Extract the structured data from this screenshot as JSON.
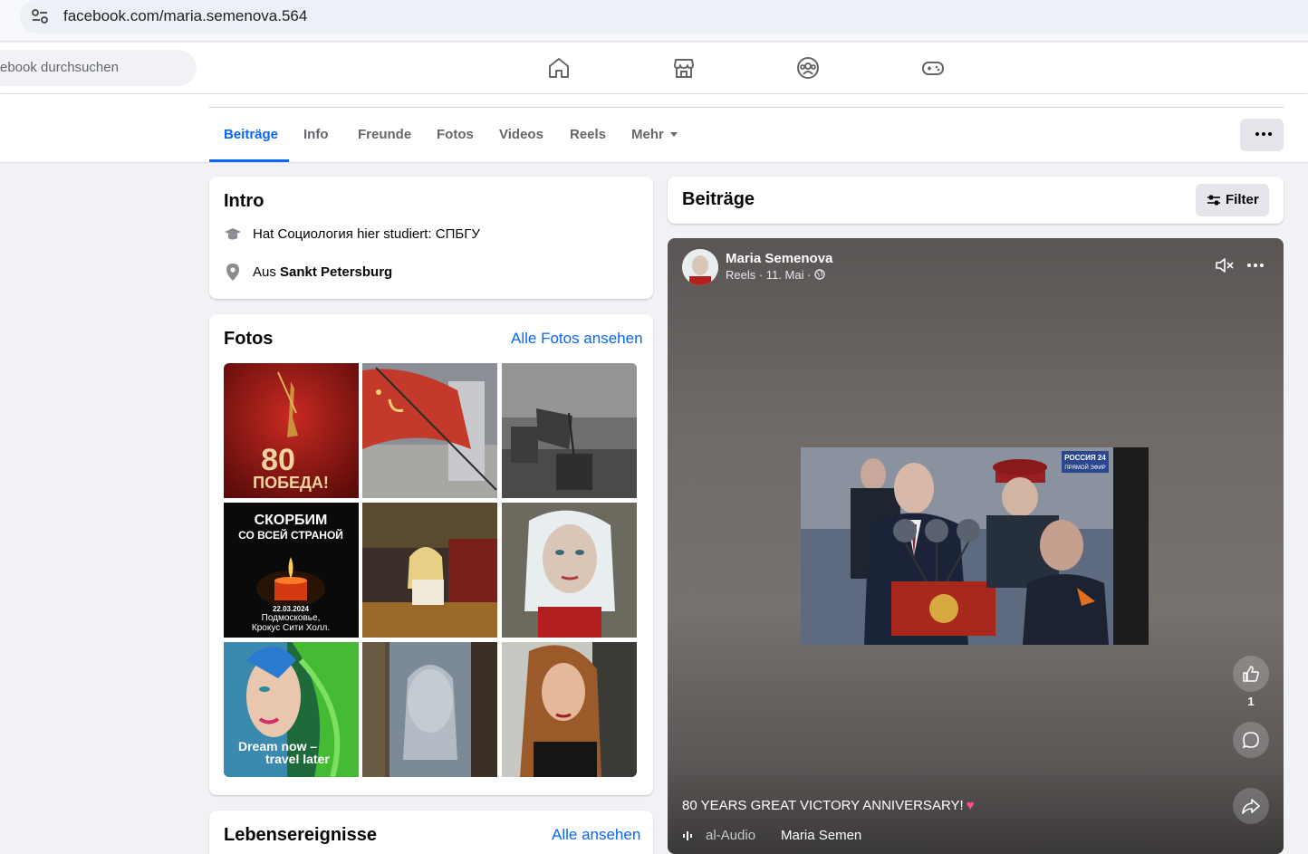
{
  "browser": {
    "url": "facebook.com/maria.semenova.564"
  },
  "header": {
    "search_placeholder": "ebook durchsuchen",
    "nav": [
      "home-icon",
      "marketplace-icon",
      "groups-icon",
      "gaming-icon"
    ]
  },
  "tabs": {
    "items": [
      {
        "label": "Beiträge"
      },
      {
        "label": "Info"
      },
      {
        "label": "Freunde"
      },
      {
        "label": "Fotos"
      },
      {
        "label": "Videos"
      },
      {
        "label": "Reels"
      },
      {
        "label": "Mehr"
      }
    ],
    "active": "Beiträge"
  },
  "intro": {
    "title": "Intro",
    "education": "Hat Социология hier studiert: СПБГУ",
    "from_prefix": "Aus ",
    "from_city": "Sankt Petersburg"
  },
  "photos": {
    "title": "Fotos",
    "see_all": "Alle Fotos ansehen",
    "items": [
      {
        "caption1": "80",
        "caption2": "ПОБЕДА!"
      },
      {
        "caption1": "",
        "caption2": ""
      },
      {
        "caption1": "",
        "caption2": ""
      },
      {
        "caption1": "СКОРБИМ",
        "caption2": "СО ВСЕЙ СТРАНОЙ",
        "caption3": "22.03.2024",
        "caption4": "Подмосковье,",
        "caption5": "Крокус Сити Холл."
      },
      {
        "caption1": "",
        "caption2": ""
      },
      {
        "caption1": "",
        "caption2": ""
      },
      {
        "caption1": "Dream now –",
        "caption2": "travel later"
      },
      {
        "caption1": "",
        "caption2": ""
      },
      {
        "caption1": "",
        "caption2": ""
      }
    ]
  },
  "life_events": {
    "title": "Lebensereignisse",
    "see_all": "Alle ansehen"
  },
  "posts": {
    "title": "Beiträge",
    "filter_label": "Filter"
  },
  "reel": {
    "author": "Maria Semenova",
    "meta": "Reels · 11. Mai · ",
    "tv_logo": "РОССИЯ 24",
    "tv_sub": "ПРЯМОЙ ЭФИР",
    "like_count": "1",
    "caption": "80 YEARS GREAT VICTORY ANNIVERSARY!",
    "audio_label": "al-Audio",
    "audio_author": "Maria Semen"
  },
  "colors": {
    "accent": "#0866ff",
    "bg": "#f0f2f5"
  }
}
